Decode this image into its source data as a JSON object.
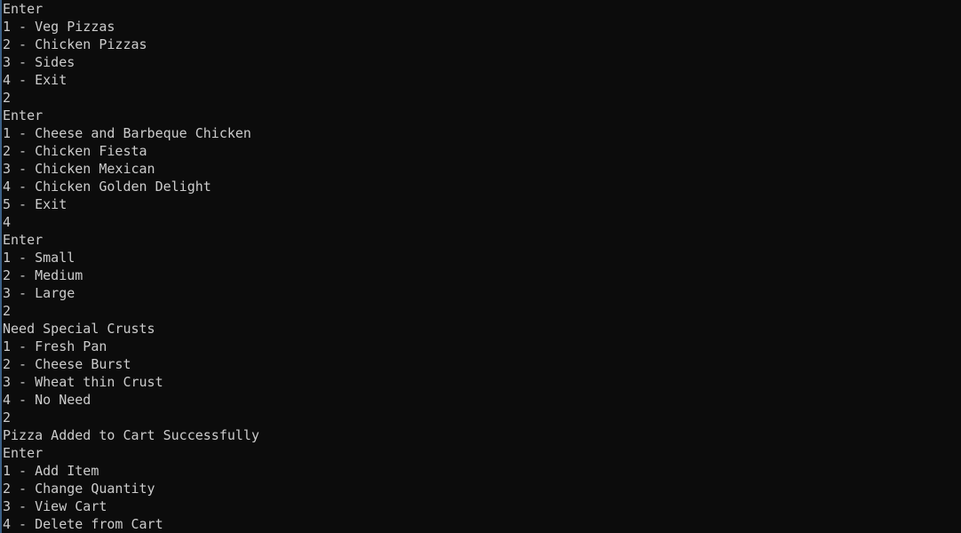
{
  "console": {
    "lines": [
      "Enter",
      "1 - Veg Pizzas",
      "2 - Chicken Pizzas",
      "3 - Sides",
      "4 - Exit",
      "2",
      "Enter",
      "1 - Cheese and Barbeque Chicken",
      "2 - Chicken Fiesta",
      "3 - Chicken Mexican",
      "4 - Chicken Golden Delight",
      "5 - Exit",
      "4",
      "Enter",
      "1 - Small",
      "2 - Medium",
      "3 - Large",
      "2",
      "Need Special Crusts",
      "1 - Fresh Pan",
      "2 - Cheese Burst",
      "3 - Wheat thin Crust",
      "4 - No Need",
      "2",
      "Pizza Added to Cart Successfully",
      "Enter",
      "1 - Add Item",
      "2 - Change Quantity",
      "3 - View Cart",
      "4 - Delete from Cart"
    ]
  },
  "colors": {
    "background": "#0c0c0c",
    "text": "#cccccc"
  }
}
